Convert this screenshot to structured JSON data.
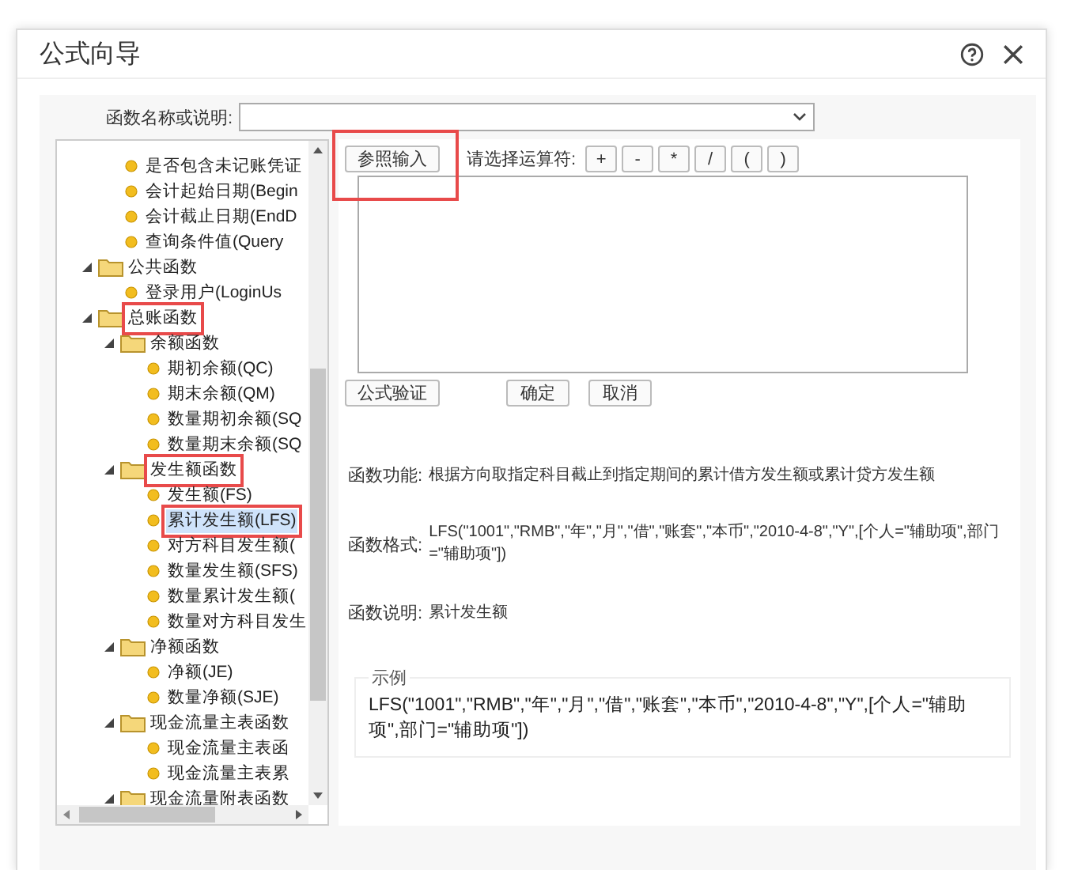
{
  "dialog": {
    "title": "公式向导"
  },
  "search": {
    "label": "函数名称或说明:"
  },
  "tree": {
    "continued_items": [
      {
        "label": "是否包含未记账凭证",
        "kind": "leaf",
        "selected": false,
        "annotated": false
      },
      {
        "label": "会计起始日期(Begin",
        "kind": "leaf",
        "selected": false,
        "annotated": false
      },
      {
        "label": "会计截止日期(EndD",
        "kind": "leaf",
        "selected": false,
        "annotated": false
      },
      {
        "label": "查询条件值(Query",
        "kind": "leaf",
        "selected": false,
        "annotated": false
      }
    ],
    "items": [
      {
        "label": "公共函数",
        "kind": "folder",
        "expanded": true,
        "selected": false,
        "annotated": false,
        "children": [
          {
            "label": "登录用户(LoginUs",
            "kind": "leaf",
            "selected": false,
            "annotated": false
          }
        ]
      },
      {
        "label": "总账函数",
        "kind": "folder",
        "expanded": true,
        "selected": false,
        "annotated": true,
        "children": [
          {
            "label": "余额函数",
            "kind": "folder",
            "expanded": true,
            "selected": false,
            "annotated": false,
            "children": [
              {
                "label": "期初余额(QC)",
                "kind": "leaf",
                "selected": false,
                "annotated": false
              },
              {
                "label": "期末余额(QM)",
                "kind": "leaf",
                "selected": false,
                "annotated": false
              },
              {
                "label": "数量期初余额(SQ",
                "kind": "leaf",
                "selected": false,
                "annotated": false
              },
              {
                "label": "数量期末余额(SQ",
                "kind": "leaf",
                "selected": false,
                "annotated": false
              }
            ]
          },
          {
            "label": "发生额函数",
            "kind": "folder",
            "expanded": true,
            "selected": false,
            "annotated": true,
            "children": [
              {
                "label": "发生额(FS)",
                "kind": "leaf",
                "selected": false,
                "annotated": false
              },
              {
                "label": "累计发生额(LFS)",
                "kind": "leaf",
                "selected": true,
                "annotated": true
              },
              {
                "label": "对方科目发生额(",
                "kind": "leaf",
                "selected": false,
                "annotated": false
              },
              {
                "label": "数量发生额(SFS)",
                "kind": "leaf",
                "selected": false,
                "annotated": false
              },
              {
                "label": "数量累计发生额(",
                "kind": "leaf",
                "selected": false,
                "annotated": false
              },
              {
                "label": "数量对方科目发生",
                "kind": "leaf",
                "selected": false,
                "annotated": false
              }
            ]
          },
          {
            "label": "净额函数",
            "kind": "folder",
            "expanded": true,
            "selected": false,
            "annotated": false,
            "children": [
              {
                "label": "净额(JE)",
                "kind": "leaf",
                "selected": false,
                "annotated": false
              },
              {
                "label": "数量净额(SJE)",
                "kind": "leaf",
                "selected": false,
                "annotated": false
              }
            ]
          },
          {
            "label": "现金流量主表函数",
            "kind": "folder",
            "expanded": true,
            "selected": false,
            "annotated": false,
            "children": [
              {
                "label": "现金流量主表函",
                "kind": "leaf",
                "selected": false,
                "annotated": false
              },
              {
                "label": "现金流量主表累",
                "kind": "leaf",
                "selected": false,
                "annotated": false
              }
            ]
          },
          {
            "label": "现金流量附表函数",
            "kind": "folder",
            "expanded": true,
            "selected": false,
            "annotated": false
          }
        ]
      }
    ]
  },
  "reference_button": {
    "label": "参照输入",
    "annotated": true
  },
  "operators": {
    "label": "请选择运算符:",
    "buttons": [
      "+",
      "-",
      "*",
      "/",
      "(",
      ")"
    ]
  },
  "actions": [
    {
      "label": "公式验证",
      "kind": "left"
    },
    {
      "label": "确定",
      "kind": "right"
    },
    {
      "label": "取消",
      "kind": "right"
    }
  ],
  "info": [
    {
      "label": "函数功能:",
      "value": "根据方向取指定科目截止到指定期间的累计借方发生额或累计贷方发生额"
    },
    {
      "label": "函数格式:",
      "value": "LFS(\"1001\",\"RMB\",\"年\",\"月\",\"借\",\"账套\",\"本币\",\"2010-4-8\",\"Y\",[个人=\"辅助项\",部门=\"辅助项\"])"
    },
    {
      "label": "函数说明:",
      "value": "累计发生额"
    }
  ],
  "example": {
    "legend": "示例",
    "text": "LFS(\"1001\",\"RMB\",\"年\",\"月\",\"借\",\"账套\",\"本币\",\"2010-4-8\",\"Y\",[个人=\"辅助项\",部门=\"辅助项\"])"
  }
}
